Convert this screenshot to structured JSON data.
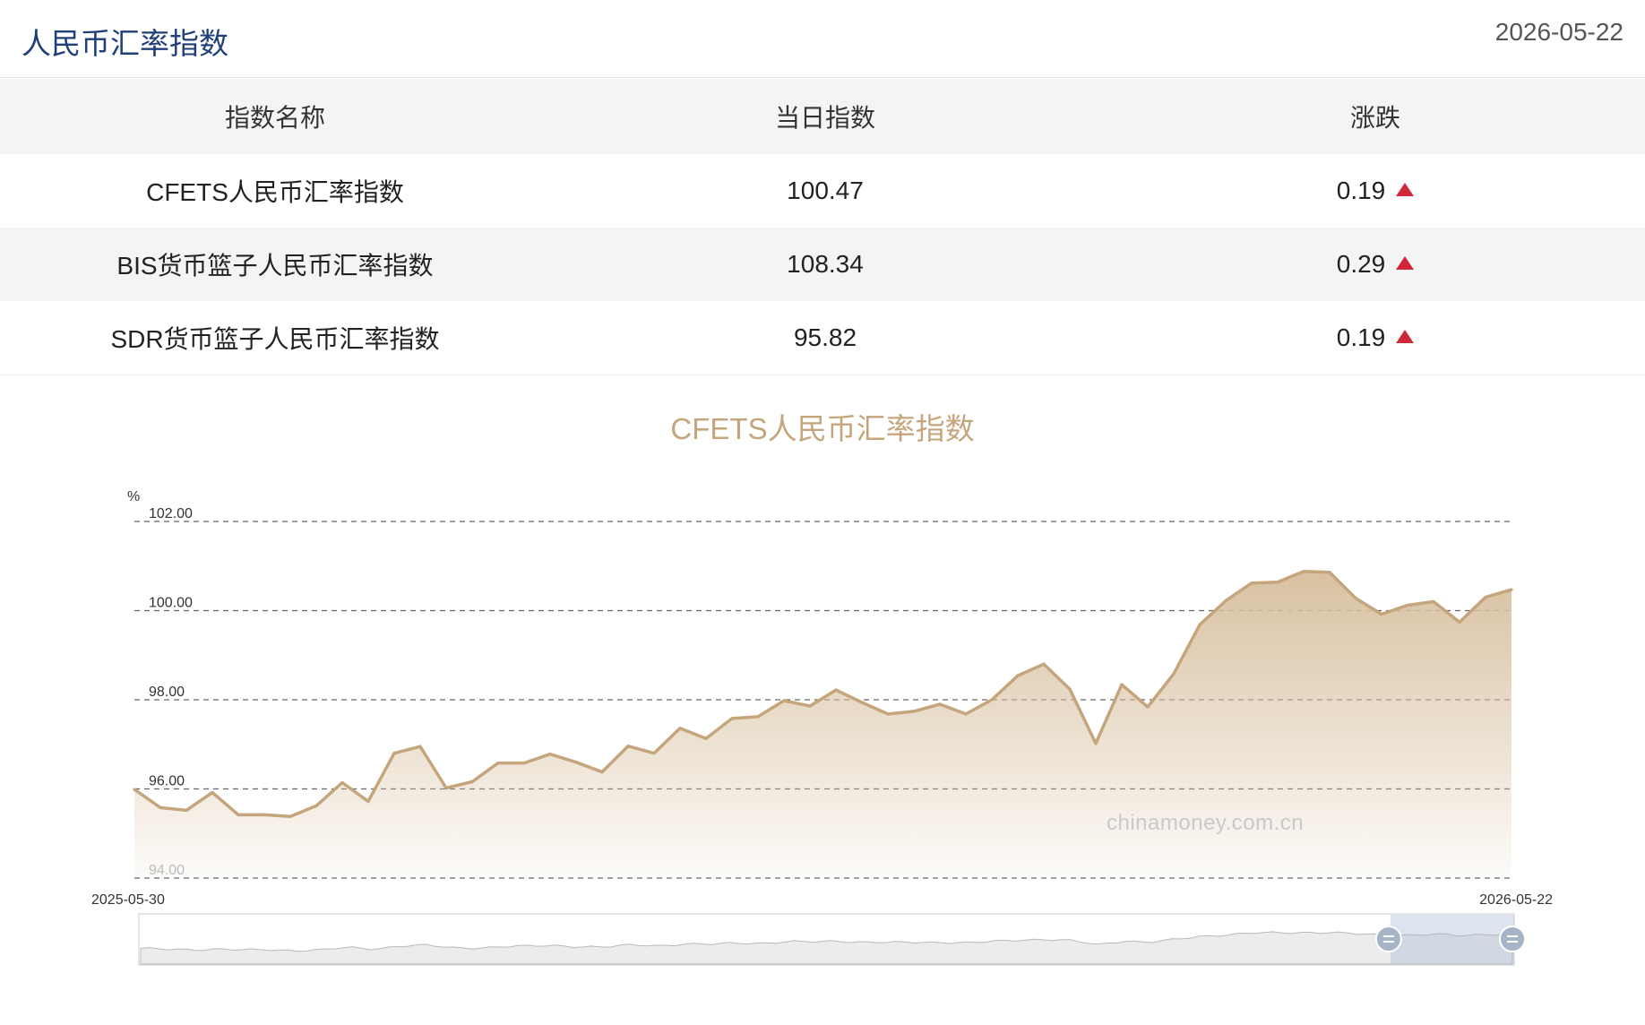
{
  "header": {
    "title": "人民币汇率指数",
    "date": "2026-05-22"
  },
  "table": {
    "columns": [
      "指数名称",
      "当日指数",
      "涨跌"
    ],
    "rows": [
      {
        "name": "CFETS人民币汇率指数",
        "value": "100.47",
        "change": "0.19"
      },
      {
        "name": "BIS货币篮子人民币汇率指数",
        "value": "108.34",
        "change": "0.29"
      },
      {
        "name": "SDR货币篮子人民币汇率指数",
        "value": "95.82",
        "change": "0.19"
      }
    ]
  },
  "colors": {
    "title_blue": "#1f3f7a",
    "up_red": "#d0283a",
    "line": "#c4a57c",
    "area_top": "#d6be9c"
  },
  "watermark": "chinamoney.com.cn",
  "chart_data": {
    "type": "area",
    "title": "CFETS人民币汇率指数",
    "ylabel": "%",
    "ylim": [
      94,
      102
    ],
    "yticks": [
      "102.00",
      "100.00",
      "98.00",
      "96.00",
      "94.00"
    ],
    "x_start_label": "2025-05-30",
    "x_end_label": "2026-05-22",
    "grid": "dashed-horizontal",
    "series": [
      {
        "values": [
          95.99,
          95.58,
          95.52,
          95.92,
          95.42,
          95.42,
          95.38,
          95.62,
          96.14,
          95.72,
          96.8,
          96.95,
          96.02,
          96.16,
          96.58,
          96.58,
          96.78,
          96.6,
          96.38,
          96.96,
          96.8,
          97.36,
          97.13,
          97.58,
          97.62,
          97.98,
          97.86,
          98.22,
          97.94,
          97.68,
          97.74,
          97.9,
          97.68,
          98.0,
          98.54,
          98.8,
          98.24,
          97.02,
          98.34,
          97.84,
          98.58,
          99.68,
          100.22,
          100.62,
          100.64,
          100.88,
          100.86,
          100.28,
          99.92,
          100.12,
          100.2,
          99.74,
          100.3,
          100.47
        ]
      }
    ]
  }
}
